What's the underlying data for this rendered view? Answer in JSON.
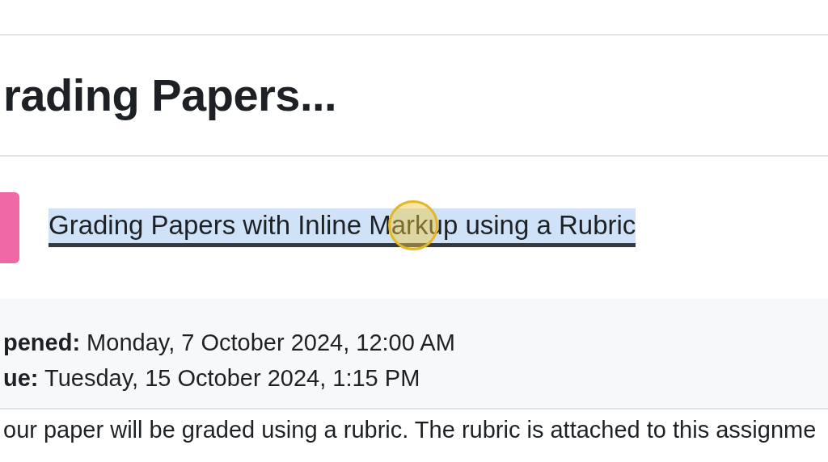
{
  "heading": "rading Papers...",
  "activity": {
    "link": "Grading Papers with Inline Markup using a Rubric",
    "selected": true,
    "hovered": true
  },
  "dates": [
    {
      "label": "pened:",
      "value": "Monday, 7 October 2024, 12:00 AM"
    },
    {
      "label": "ue:",
      "value": "Tuesday, 15 October 2024, 1:15 PM"
    }
  ],
  "description": "our paper will be graded using a rubric. The rubric is attached to this assignme"
}
